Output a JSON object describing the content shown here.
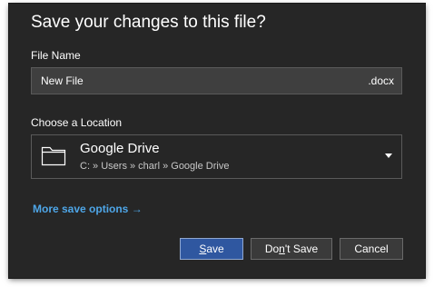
{
  "dialog": {
    "title": "Save your changes to this file?",
    "file_name_label": "File Name",
    "file_name_value": "New File",
    "extension": ".docx",
    "location_label": "Choose a Location",
    "location": {
      "name": "Google Drive",
      "path": "C: » Users » charl » Google Drive",
      "icon": "folder-icon"
    },
    "more_options": "More save options →",
    "buttons": {
      "save_mnemonic": "S",
      "save_rest": "ave",
      "dontsave_pre": "Do",
      "dontsave_mnemonic": "n",
      "dontsave_post": "'t Save",
      "cancel": "Cancel"
    }
  },
  "colors": {
    "dialog_bg": "#262626",
    "input_bg": "#3f3f3f",
    "link": "#4ea6e8",
    "primary_button": "#2f57a0"
  }
}
